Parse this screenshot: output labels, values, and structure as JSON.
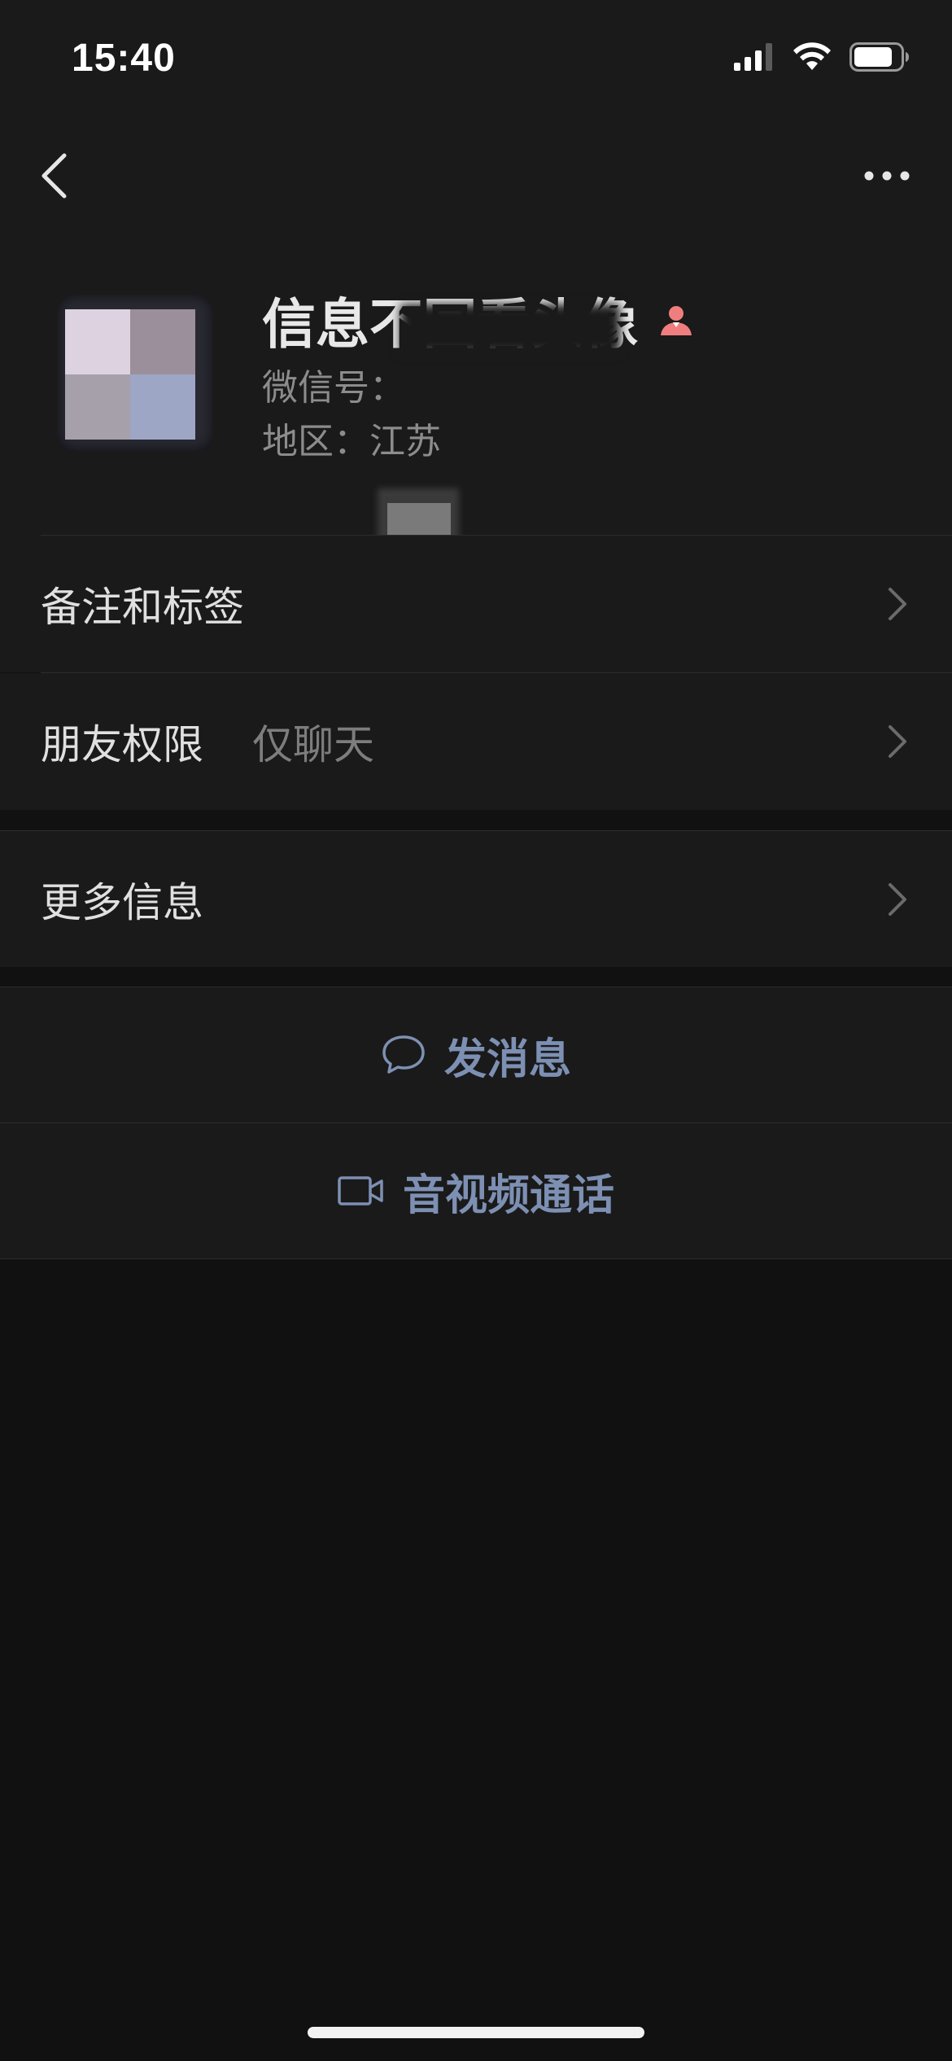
{
  "status_bar": {
    "time": "15:40",
    "icons": [
      "cellular-signal-icon",
      "wifi-icon",
      "battery-icon"
    ]
  },
  "nav": {
    "back_icon": "chevron-left-icon",
    "more_icon": "more-dots-icon"
  },
  "profile": {
    "name": "信息不回看头像",
    "gender_icon": "female-user-icon",
    "gender_color": "#f07e7e",
    "wechat_id_label": "微信号：",
    "region_label": "地区：江苏"
  },
  "rows": [
    {
      "label": "备注和标签",
      "value": ""
    },
    {
      "label": "朋友权限",
      "value": "仅聊天"
    },
    {
      "label": "更多信息",
      "value": ""
    }
  ],
  "actions": [
    {
      "label": "发消息",
      "icon": "chat-bubble-icon"
    },
    {
      "label": "音视频通话",
      "icon": "video-camera-icon"
    }
  ],
  "colors": {
    "background": "#111111",
    "surface": "#1a1a1a",
    "action_text": "#7d90b3",
    "secondary_text": "#8c8c8c"
  }
}
